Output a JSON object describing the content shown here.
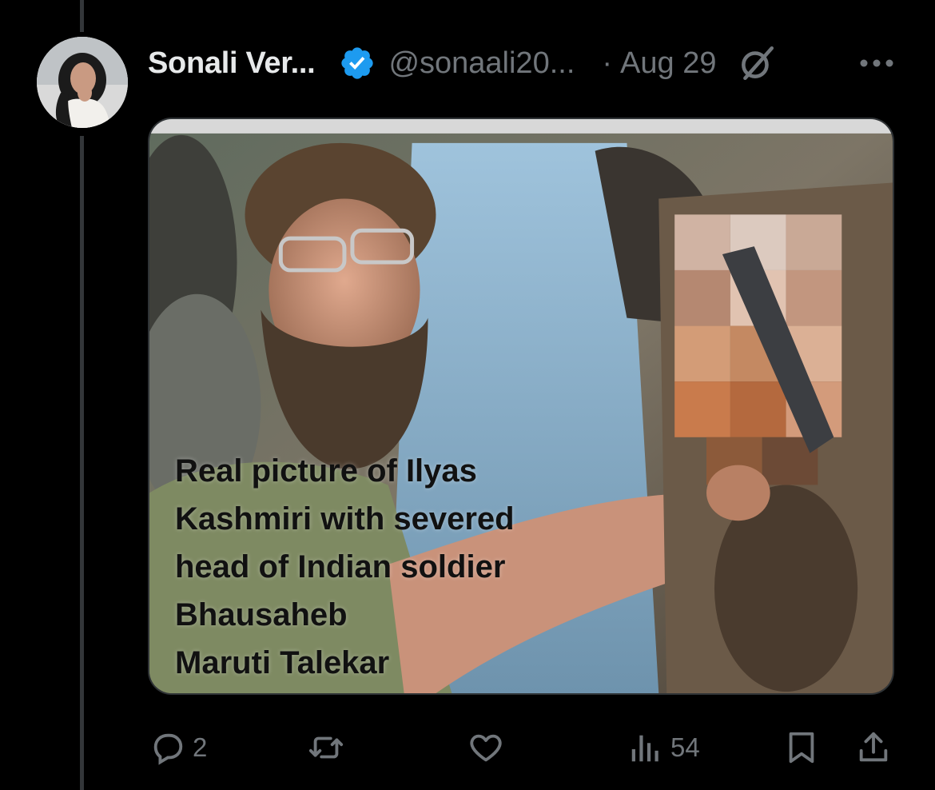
{
  "post": {
    "author": {
      "display_name": "Sonali Ver...",
      "handle": "@sonaali20...",
      "verified": true
    },
    "separator": "·",
    "date": "Aug 29",
    "media": {
      "caption_lines": [
        "Real picture of Ilyas",
        "Kashmiri with severed",
        "head of Indian soldier",
        "Bhausaheb",
        "Maruti Talekar"
      ]
    },
    "actions": {
      "replies": "2",
      "reposts": "",
      "likes": "",
      "views": "54"
    }
  },
  "icons": {
    "verified": "verified-badge-icon",
    "grok": "grok-icon",
    "more": "more-icon",
    "reply": "reply-icon",
    "repost": "repost-icon",
    "like": "heart-icon",
    "views": "views-icon",
    "bookmark": "bookmark-icon",
    "share": "share-icon"
  },
  "colors": {
    "background": "#000000",
    "text_primary": "#e7e9ea",
    "text_secondary": "#71767b",
    "verified_blue": "#1d9bf0"
  }
}
